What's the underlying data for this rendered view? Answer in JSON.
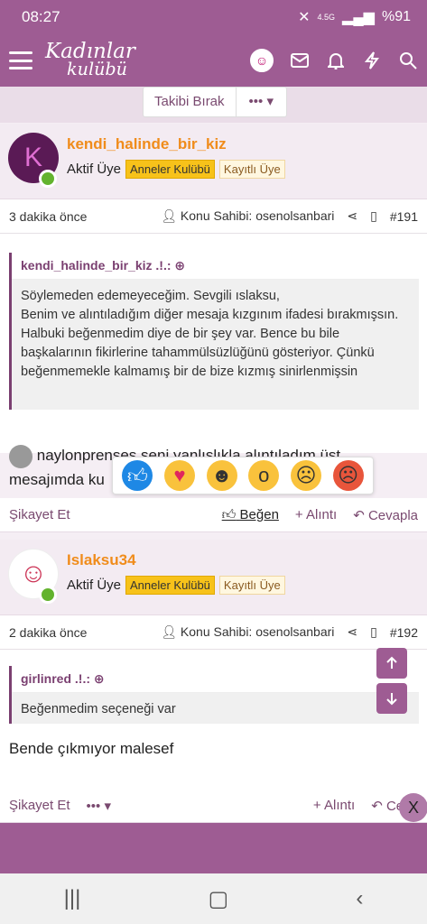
{
  "status": {
    "time": "08:27",
    "battery": "%91",
    "network": "4.5G"
  },
  "nav": {
    "logo_line1": "Kadınlar",
    "logo_line2": "kulübü"
  },
  "follow": {
    "unfollow_label": "Takibi Bırak",
    "more_label": "••• ▾"
  },
  "posts": [
    {
      "initial": "K",
      "username": "kendi_halinde_bir_kiz",
      "role": "Aktif Üye",
      "badge1": "Anneler Kulübü",
      "badge2": "Kayıtlı Üye",
      "time": "3 dakika önce",
      "owner": "Konu Sahibi: osenolsanbari",
      "number": "#191",
      "quote_author": "kendi_halinde_bir_kiz .!.: ⊕",
      "quote_text": "Söylemeden edemeyeceğim. Sevgili ıslaksu,\nBenim ve alıntıladığım diğer mesaja kızgınım ifadesi bırakmışsın. Halbuki beğenmedim diye de bir şey var. Bence bu bile başkalarının fikirlerine tahammülsüzlüğünü gösteriyor. Çünkü beğenmemekle kalmamış bir de bize kızmış sinirlenmişsin",
      "message_line1": "naylonprenses seni yanlışlıkla alıntıladım üst",
      "message_line2": "mesajımda ku",
      "report": "Şikayet Et",
      "like": "Beğen",
      "quote_action": "+ Alıntı",
      "reply": "Cevapla"
    },
    {
      "username": "Islaksu34",
      "role": "Aktif Üye",
      "badge1": "Anneler Kulübü",
      "badge2": "Kayıtlı Üye",
      "time": "2 dakika önce",
      "owner": "Konu Sahibi: osenolsanbari",
      "number": "#192",
      "quote_author": "girlinred .!.: ⊕",
      "quote_text": "Beğenmedim seçeneği var",
      "message": "Bende çıkmıyor malesef",
      "report": "Şikayet Et",
      "more": "••• ▾",
      "quote_action": "+ Alıntı",
      "reply": "Ceva"
    }
  ],
  "reactions": [
    "like",
    "love",
    "laugh",
    "wow",
    "sad",
    "angry"
  ],
  "close_label": "X"
}
